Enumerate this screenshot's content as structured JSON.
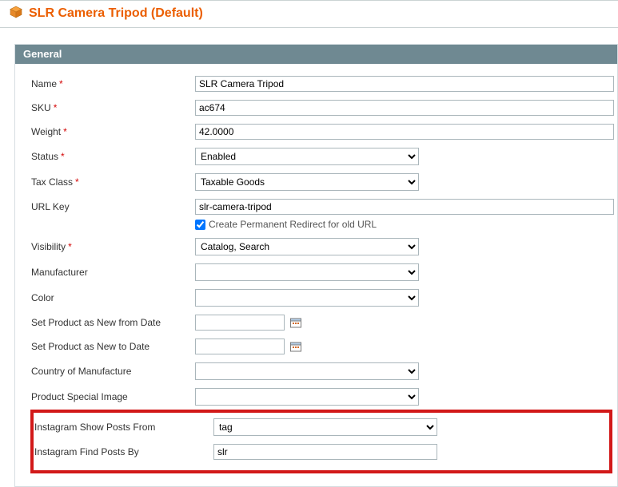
{
  "page_title": "SLR Camera Tripod (Default)",
  "section_header": "General",
  "labels": {
    "name": "Name",
    "sku": "SKU",
    "weight": "Weight",
    "status": "Status",
    "tax_class": "Tax Class",
    "url_key": "URL Key",
    "visibility": "Visibility",
    "manufacturer": "Manufacturer",
    "color": "Color",
    "new_from": "Set Product as New from Date",
    "new_to": "Set Product as New to Date",
    "country": "Country of Manufacture",
    "special_image": "Product Special Image",
    "ig_show": "Instagram Show Posts From",
    "ig_find": "Instagram Find Posts By",
    "redirect": "Create Permanent Redirect for old URL",
    "required_marker": "*"
  },
  "values": {
    "name": "SLR Camera Tripod",
    "sku": "ac674",
    "weight": "42.0000",
    "status": "Enabled",
    "tax_class": "Taxable Goods",
    "url_key": "slr-camera-tripod",
    "visibility": "Catalog, Search",
    "manufacturer": "",
    "color": "",
    "new_from": "",
    "new_to": "",
    "country": "",
    "special_image": "",
    "ig_show": "tag",
    "ig_find": "slr",
    "redirect_checked": true
  }
}
